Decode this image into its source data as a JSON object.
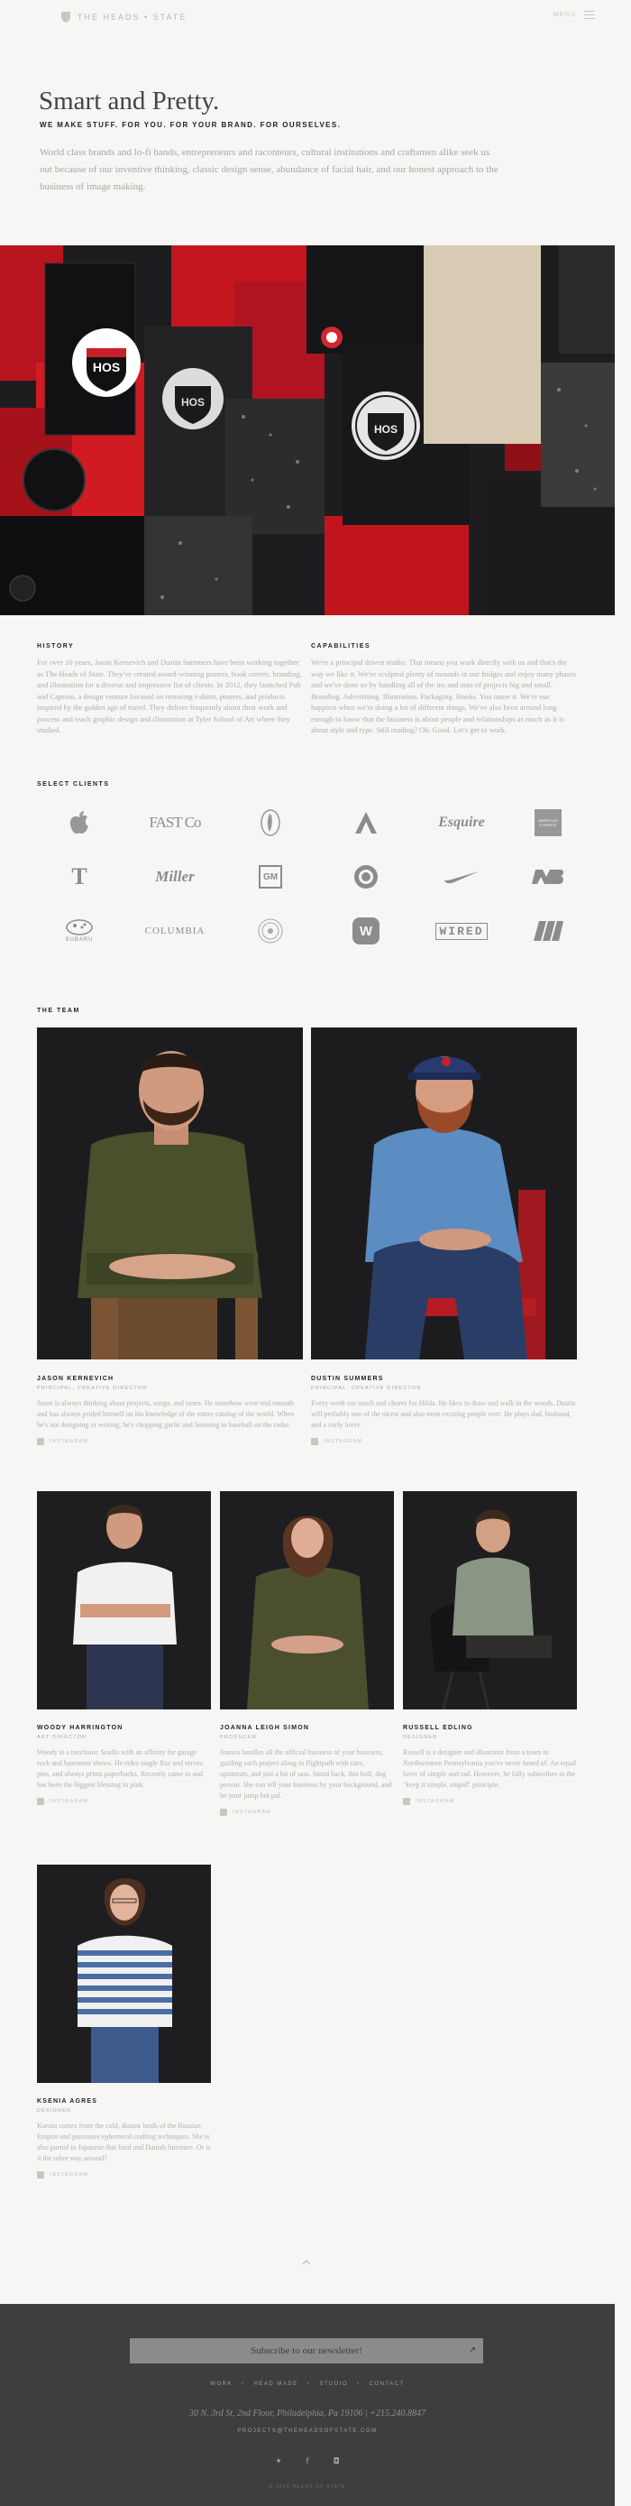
{
  "header": {
    "brand": "THE HEADS • STATE",
    "menu_label": "MENU"
  },
  "hero": {
    "title": "Smart and Pretty.",
    "tagline": "WE MAKE STUFF. FOR YOU. FOR YOUR BRAND. FOR OURSELVES.",
    "description": "World class brands and lo-fi bands, entrepreneurs and raconteurs, cultural institutions and craftsmen alike seek us out because of our inventive thinking, classic design sense, abundance of facial hair, and our honest approach to the business of image making.",
    "image_alt": "Flat lay of red and black notebooks with Heads of State HOS stickers"
  },
  "history": {
    "heading": "HISTORY",
    "text": "For over 10 years, Jason Kernevich and Dustin Summers have been working together as The Heads of State. They've created award-winning posters, book covers, branding, and illustration for a diverse and impressive list of clients. In 2012, they launched Pub and Caption, a design venture focused on restoring t-shirts, posters, and products inspired by the golden age of travel. They deliver frequently about their work and process and teach graphic design and illustration at Tyler School of Art where they studied."
  },
  "capabilities": {
    "heading": "CAPABILITIES",
    "text": "We're a principal driven studio. That means you work directly with us and that's the way we like it. We've sculpted plenty of mounds in our fridges and enjoy many phases and we've done so by handling all of the ins and outs of projects big and small. Branding. Advertising. Illustration. Packaging. Books. You name it. We're our happiest when we're doing a lot of different things. We've also been around long enough to know that the business is about people and relationships as much as it is about style and type. Still reading? Oh. Good. Let's get to work."
  },
  "clients": {
    "heading": "SELECT CLIENTS",
    "logos": [
      {
        "name": "apple",
        "label": ""
      },
      {
        "name": "fastco",
        "label": "FAST Co"
      },
      {
        "name": "penguin",
        "label": ""
      },
      {
        "name": "adobe",
        "label": ""
      },
      {
        "name": "esquire",
        "label": "Esquire"
      },
      {
        "name": "amex",
        "label": "AMERICAN EXPRESS"
      },
      {
        "name": "nyt",
        "label": "T"
      },
      {
        "name": "miller",
        "label": "Miller"
      },
      {
        "name": "gm",
        "label": "GM"
      },
      {
        "name": "starbucks",
        "label": ""
      },
      {
        "name": "nike",
        "label": ""
      },
      {
        "name": "newbalance",
        "label": ""
      },
      {
        "name": "subaru",
        "label": "SUBARU"
      },
      {
        "name": "columbia",
        "label": "COLUMBIA"
      },
      {
        "name": "seal",
        "label": ""
      },
      {
        "name": "warner",
        "label": "W"
      },
      {
        "name": "wired",
        "label": "WIRED"
      },
      {
        "name": "wilson",
        "label": ""
      }
    ]
  },
  "team": {
    "heading": "THE TEAM",
    "instagram_label": "INSTAGRAM",
    "members": [
      {
        "name": "JASON KERNEVICH",
        "role": "PRINCIPAL, CREATIVE DIRECTOR",
        "bio": "Jason is always thinking about projects, songs, and tunes. He somehow went real smooth and has always prided himself on his knowledge of the entire catalog of the world. When he's not designing or writing, he's chopping garlic and listening to baseball on the radio."
      },
      {
        "name": "DUSTIN SUMMERS",
        "role": "PRINCIPAL, CREATIVE DIRECTOR",
        "bio": "Every week too much and chores for Hilda. He likes to draw and walk in the woods. Dustin will probably one of the nicest and also most exciting people ever. He plays dad, husband, and a curly lover."
      },
      {
        "name": "WOODY HARRINGTON",
        "role": "ART DIRECTOR",
        "bio": "Woody is a mechanic Studio with an affinity for garage rock and basement shows. He rides single fixe and serves pies, and always prints paperbacks. Recently came in and has been the biggest blessing in pink."
      },
      {
        "name": "JOANNA LEIGH SIMON",
        "role": "PRODUCER",
        "bio": "Joanna handles all the official business of your business, guiding each project along to flightpath with care, optimism, and just a bit of sass. Stand back, this bull, dog person. She can tell your business by your background, and be your jump bot pal."
      },
      {
        "name": "RUSSELL EDLING",
        "role": "DESIGNER",
        "bio": "Russell is a designer and illustrator from a town in Northwestern Pennsylvania you've never heard of. An equal lover of simple and rad. However, he fully subscribes to the \"keep it simple, stupid\" principle."
      },
      {
        "name": "KSENIA AGRES",
        "role": "DESIGNER",
        "bio": "Ksenia comes from the cold, distant lands of the Russian Empire and possesses ephemeral crafting techniques. She is also partial to Japanese thai food and Danish furniture. Or is it the other way around?"
      }
    ]
  },
  "footer": {
    "newsletter_label": "Subscribe to our newsletter!",
    "nav": [
      "WORK",
      "HEAD MADE",
      "STUDIO",
      "CONTACT"
    ],
    "address": "30 N. 3rd St, 2nd Floor, Philadelphia, Pa 19106 | +215.240.8847",
    "email": "PROJECTS@THEHEADSOFSTATE.COM",
    "social": [
      "twitter-icon",
      "facebook-icon",
      "instagram-icon"
    ],
    "copyright": "© 2015 HEADS OF STATE"
  },
  "colors": {
    "background": "#f7f6f4",
    "footer": "#3e3e3e",
    "accent_red": "#c8202a"
  }
}
